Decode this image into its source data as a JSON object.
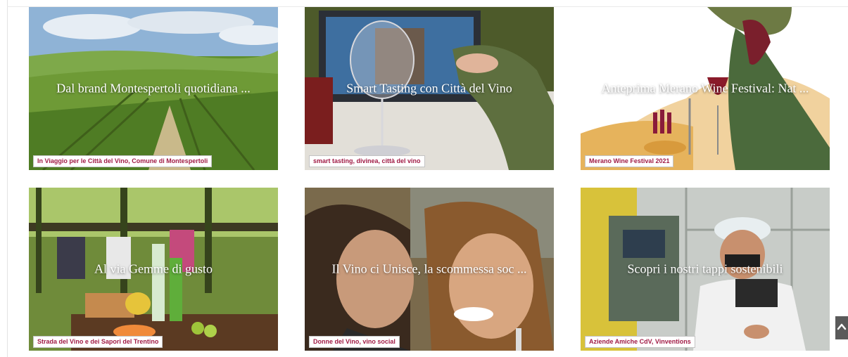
{
  "cards": [
    {
      "title": "Dal brand Montespertoli quotidiana ...",
      "tags": "In Viaggio per le Città del Vino, Comune di Montespertoli"
    },
    {
      "title": "Smart Tasting con Città del Vino",
      "tags": "smart tasting, divinea, città del vino"
    },
    {
      "title": "Anteprima Merano Wine Festival: Nat ...",
      "tags": "Merano Wine Festival 2021"
    },
    {
      "title": "Al via Gemme di gusto",
      "tags": "Strada del Vino e dei Sapori del Trentino"
    },
    {
      "title": "Il Vino ci Unisce, la scommessa soc ...",
      "tags": "Donne del Vino, vino social"
    },
    {
      "title": "Scopri i nostri tappi sostenibili",
      "tags": "Aziende Amiche CdV, Vinventions"
    }
  ],
  "scroll_top": {
    "icon": "chevron-up-icon"
  },
  "colors": {
    "tag_text": "#a01b45",
    "tag_border": "#c4c4c4",
    "title_text": "#ffffff"
  }
}
